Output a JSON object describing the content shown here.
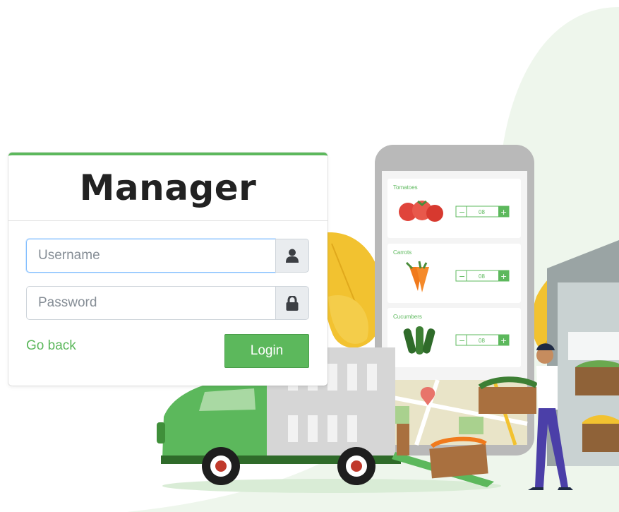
{
  "login": {
    "title": "Manager",
    "username_placeholder": "Username",
    "password_placeholder": "Password",
    "go_back_label": "Go back",
    "login_button_label": "Login"
  },
  "phone_app": {
    "products": [
      {
        "name": "Tomatoes",
        "quantity": "08"
      },
      {
        "name": "Carrots",
        "quantity": "08"
      },
      {
        "name": "Cucumbers",
        "quantity": "08"
      }
    ],
    "minus_symbol": "−",
    "plus_symbol": "+"
  },
  "colors": {
    "accent": "#5cb85c",
    "background_blob": "#eef6ec",
    "truck_green": "#5cb85c",
    "phone_frame": "#b9b9b9"
  },
  "icons": {
    "username_icon": "user-icon",
    "password_icon": "lock-icon"
  }
}
